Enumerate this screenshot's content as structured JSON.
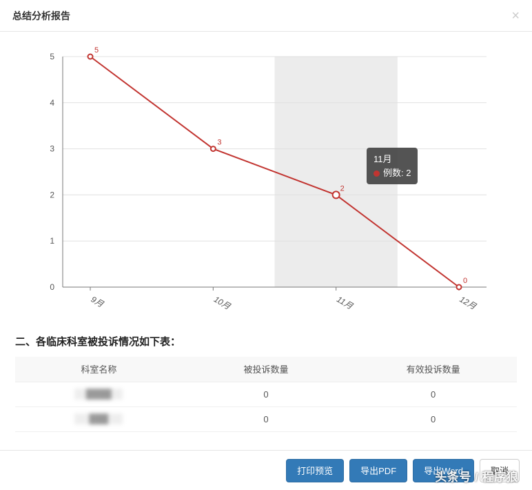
{
  "modal": {
    "title": "总结分析报告",
    "close_label": "×"
  },
  "chart_data": {
    "type": "line",
    "categories": [
      "9月",
      "10月",
      "11月",
      "12月"
    ],
    "values": [
      5,
      3,
      2,
      0
    ],
    "series_name": "例数",
    "ylabel": "",
    "xlabel": "",
    "ylim": [
      0,
      5
    ],
    "yticks": [
      0,
      1,
      2,
      3,
      4,
      5
    ],
    "highlight_index": 2,
    "tooltip": {
      "category": "11月",
      "series": "例数",
      "value": 2
    }
  },
  "section2": {
    "title": "二、各临床科室被投诉情况如下表：",
    "headers": [
      "科室名称",
      "被投诉数量",
      "有效投诉数量"
    ],
    "rows": [
      {
        "dept": "████",
        "complained": 0,
        "valid": 0
      },
      {
        "dept": "███",
        "complained": 0,
        "valid": 0
      }
    ]
  },
  "footer": {
    "print_preview": "打印预览",
    "export_pdf": "导出PDF",
    "export_word": "导出Word",
    "cancel": "取消"
  },
  "watermark": "头条号 / 程序狼"
}
